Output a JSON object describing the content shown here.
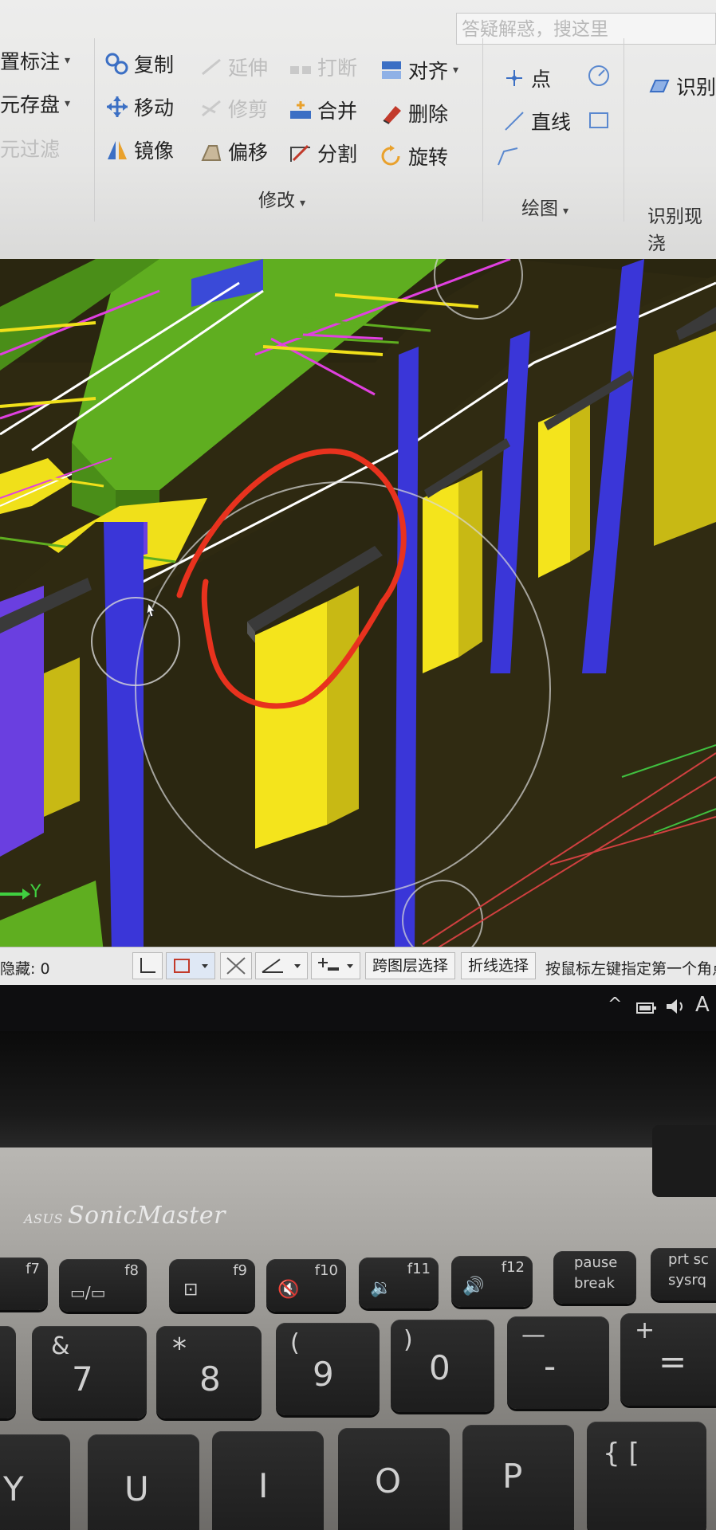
{
  "ribbon": {
    "search_placeholder": "答疑解惑，搜这里",
    "left_items": [
      "置标注",
      "元存盘",
      "元过滤"
    ],
    "modify": {
      "col1": [
        "复制",
        "移动",
        "镜像"
      ],
      "col2": [
        "延伸",
        "修剪",
        "偏移"
      ],
      "col3": [
        "打断",
        "合并",
        "分割"
      ],
      "col4": [
        "对齐",
        "删除",
        "旋转"
      ],
      "group_label": "修改"
    },
    "draw": {
      "items": [
        "点",
        "直线"
      ],
      "group_label": "绘图"
    },
    "identify": {
      "item": "识别",
      "group_label": "识别现浇"
    }
  },
  "viewport": {
    "axis_label": "Y",
    "annotation_color": "#e8321e"
  },
  "statusbar": {
    "hidden_count": "隐藏: 0",
    "btn_cross_layer": "跨图层选择",
    "btn_polyline": "折线选择",
    "hint": "按鼠标左键指定第一个角点"
  },
  "taskbar": {
    "tray_chevron": "^",
    "tray_lang": "A"
  },
  "laptop": {
    "brand_prefix": "ASUS",
    "brand": "SonicMaster",
    "fn_keys": [
      {
        "top": "f7",
        "main": ""
      },
      {
        "top": "f8",
        "main": "▭/▭"
      },
      {
        "top": "f9",
        "main": "⊡"
      },
      {
        "top": "f10",
        "main": "🔇"
      },
      {
        "top": "f11",
        "main": "🔉"
      },
      {
        "top": "f12",
        "main": "🔊"
      },
      {
        "top": "pause",
        "main": "break"
      },
      {
        "top": "prt sc",
        "main": "sysrq"
      }
    ],
    "num_keys": [
      {
        "top": "&",
        "main": "7"
      },
      {
        "top": "*",
        "main": "8"
      },
      {
        "top": "(",
        "main": "9"
      },
      {
        "top": ")",
        "main": "0"
      },
      {
        "top": "—",
        "main": "-"
      },
      {
        "top": "+",
        "main": "="
      }
    ],
    "letter_keys": [
      "Y",
      "U",
      "I",
      "O",
      "P",
      "{ ["
    ]
  }
}
